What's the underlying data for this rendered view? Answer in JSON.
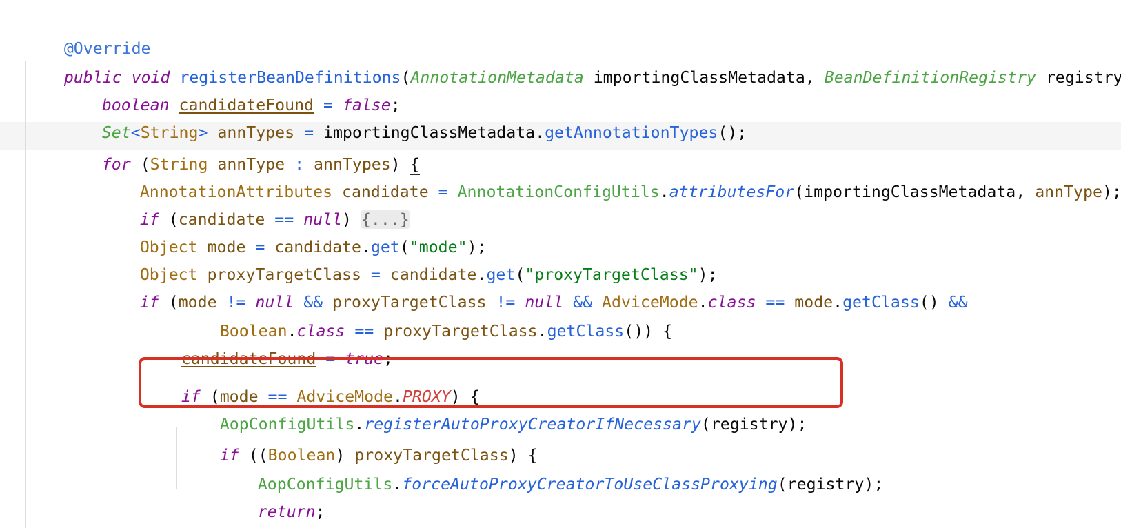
{
  "code": {
    "l1": {
      "annotation": "@Override"
    },
    "l2": {
      "t1": "public",
      "t2": " ",
      "t3": "void",
      "t4": " ",
      "t5": "registerBeanDefinitions",
      "t6": "(",
      "t7": "AnnotationMetadata",
      "t8": " importingClassMetadata, ",
      "t9": "BeanDefinitionRegistry",
      "t10": " registry) {"
    },
    "l3": {
      "t1": "boolean",
      "t2": " ",
      "t3": "candidateFound",
      "t4": " ",
      "t5": "=",
      "t6": " ",
      "t7": "false",
      "t8": ";"
    },
    "l4": {
      "t1": "Set",
      "t2": "<",
      "t3": "String",
      "t4": ">",
      "t5": " ",
      "t6": "annTypes",
      "t7": " ",
      "t8": "=",
      "t9": " importingClassMetadata.",
      "t10": "getAnnotationTypes",
      "t11": "();"
    },
    "l5": {
      "t1": "for",
      "t2": " (",
      "t3": "String",
      "t4": " ",
      "t5": "annType",
      "t6": " ",
      "t7": ":",
      "t8": " ",
      "t9": "annTypes",
      "t10": ") ",
      "t11": "{"
    },
    "l6": {
      "t1": "AnnotationAttributes",
      "t2": " ",
      "t3": "candidate",
      "t4": " ",
      "t5": "=",
      "t6": " ",
      "t7": "AnnotationConfigUtils",
      "t8": ".",
      "t9": "attributesFor",
      "t10": "(importingClassMetadata, ",
      "t11": "annType",
      "t12": ");"
    },
    "l7": {
      "t1": "if",
      "t2": " (",
      "t3": "candidate",
      "t4": " ",
      "t5": "==",
      "t6": " ",
      "t7": "null",
      "t8": ") ",
      "t9": "{...}"
    },
    "l8": {
      "t1": "Object",
      "t2": " ",
      "t3": "mode",
      "t4": " ",
      "t5": "=",
      "t6": " ",
      "t7": "candidate",
      "t8": ".",
      "t9": "get",
      "t10": "(",
      "t11": "\"mode\"",
      "t12": ");"
    },
    "l9": {
      "t1": "Object",
      "t2": " ",
      "t3": "proxyTargetClass",
      "t4": " ",
      "t5": "=",
      "t6": " ",
      "t7": "candidate",
      "t8": ".",
      "t9": "get",
      "t10": "(",
      "t11": "\"proxyTargetClass\"",
      "t12": ");"
    },
    "l10": {
      "t1": "if",
      "t2": " (",
      "t3": "mode",
      "t4": " ",
      "t5": "!=",
      "t6": " ",
      "t7": "null",
      "t8": " ",
      "t9": "&&",
      "t10": " ",
      "t11": "proxyTargetClass",
      "t12": " ",
      "t13": "!=",
      "t14": " ",
      "t15": "null",
      "t16": " ",
      "t17": "&&",
      "t18": " ",
      "t19": "AdviceMode",
      "t20": ".",
      "t21": "class",
      "t22": " ",
      "t23": "==",
      "t24": " ",
      "t25": "mode",
      "t26": ".",
      "t27": "getClass",
      "t28": "() ",
      "t29": "&&"
    },
    "l11": {
      "t1": "Boolean",
      "t2": ".",
      "t3": "class",
      "t4": " ",
      "t5": "==",
      "t6": " ",
      "t7": "proxyTargetClass",
      "t8": ".",
      "t9": "getClass",
      "t10": "()) {"
    },
    "l12": {
      "t1": "candidateFound",
      "t2": " ",
      "t3": "=",
      "t4": " ",
      "t5": "true",
      "t6": ";"
    },
    "l13": {
      "t1": "if",
      "t2": " (",
      "t3": "mode",
      "t4": " ",
      "t5": "==",
      "t6": " ",
      "t7": "AdviceMode",
      "t8": ".",
      "t9": "PROXY",
      "t10": ") {"
    },
    "l14": {
      "t1": "AopConfigUtils",
      "t2": ".",
      "t3": "registerAutoProxyCreatorIfNecessary",
      "t4": "(registry);"
    },
    "l15": {
      "t1": "if",
      "t2": " ((",
      "t3": "Boolean",
      "t4": ") ",
      "t5": "proxyTargetClass",
      "t6": ") {"
    },
    "l16": {
      "t1": "AopConfigUtils",
      "t2": ".",
      "t3": "forceAutoProxyCreatorToUseClassProxying",
      "t4": "(registry);"
    },
    "l17": {
      "t1": "return",
      "t2": ";"
    },
    "l18": {
      "t1": "}"
    }
  },
  "colors": {
    "keyword": "#871094",
    "class_name": "#4ca444",
    "primitive_type": "#a06d12",
    "variable": "#7a5313",
    "method": "#2662d9",
    "string": "#067d17",
    "enum_constant": "#d0413b",
    "highlight_box": "#d93025",
    "current_line": "#f5f5f5"
  }
}
